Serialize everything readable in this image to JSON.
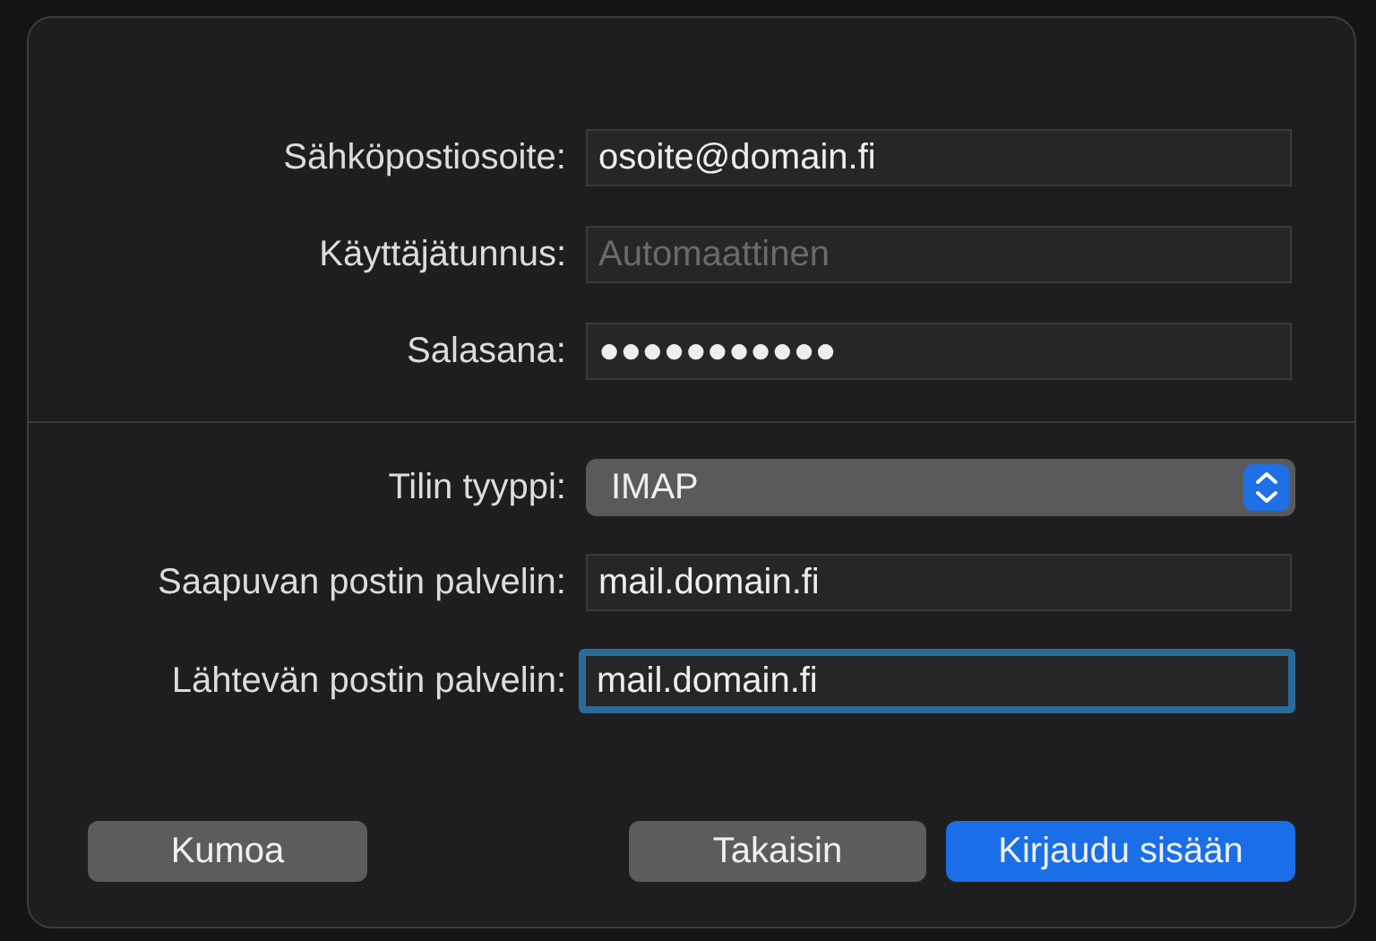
{
  "account_fields": [
    {
      "label": "Sähköpostiosoite:",
      "value": "osoite@domain.fi",
      "focused": false
    },
    {
      "label": "Käyttäjätunnus:",
      "placeholder": "Automaattinen",
      "focused": false
    },
    {
      "label": "Salasana:",
      "value": "●●●●●●●●●●●",
      "focused": false
    }
  ],
  "server_fields": [
    {
      "kind": "popup",
      "label": "Tilin tyyppi:",
      "value": "IMAP",
      "focused": false
    },
    {
      "kind": "text",
      "label": "Saapuvan postin palvelin:",
      "value": "mail.domain.fi",
      "focused": false
    },
    {
      "kind": "text",
      "label": "Lähtevän postin palvelin:",
      "value": "mail.domain.fi",
      "focused": true
    }
  ],
  "buttons": [
    {
      "label": "Kumoa",
      "kind": "secondary"
    },
    {
      "label": "Takaisin",
      "kind": "secondary"
    },
    {
      "label": "Kirjaudu sisään",
      "kind": "primary"
    }
  ]
}
